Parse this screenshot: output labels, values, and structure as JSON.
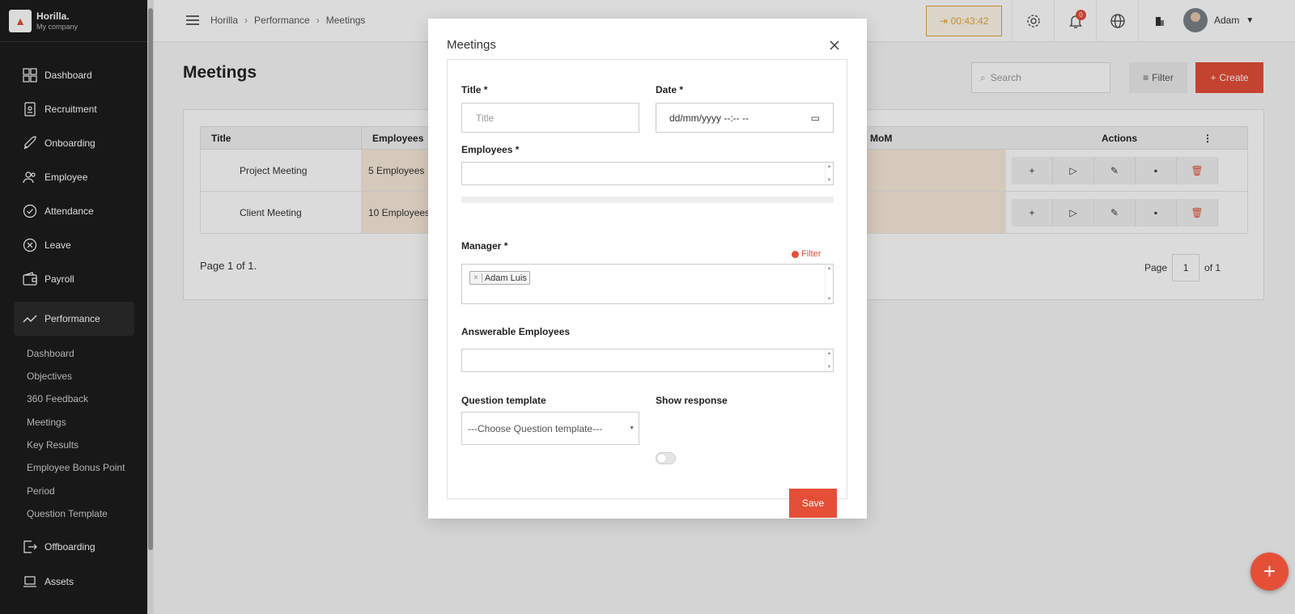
{
  "brand": {
    "name": "Horilla.",
    "company": "My company"
  },
  "sidebar": {
    "items": [
      {
        "label": "Dashboard",
        "icon": "dashboard-icon"
      },
      {
        "label": "Recruitment",
        "icon": "recruitment-icon"
      },
      {
        "label": "Onboarding",
        "icon": "rocket-icon"
      },
      {
        "label": "Employee",
        "icon": "users-icon"
      },
      {
        "label": "Attendance",
        "icon": "check-circle-icon"
      },
      {
        "label": "Leave",
        "icon": "x-circle-icon"
      },
      {
        "label": "Payroll",
        "icon": "wallet-icon"
      },
      {
        "label": "Performance",
        "icon": "trend-icon"
      },
      {
        "label": "Offboarding",
        "icon": "exit-icon"
      },
      {
        "label": "Assets",
        "icon": "laptop-icon"
      }
    ],
    "performance_sub": [
      "Dashboard",
      "Objectives",
      "360 Feedback",
      "Meetings",
      "Key Results",
      "Employee Bonus Point",
      "Period",
      "Question Template"
    ]
  },
  "topbar": {
    "breadcrumbs": [
      "Horilla",
      "Performance",
      "Meetings"
    ],
    "timer": "00:43:42",
    "notification_count": "0",
    "user_name": "Adam"
  },
  "page": {
    "title": "Meetings",
    "search_placeholder": "Search",
    "filter_label": "Filter",
    "create_label": "Create"
  },
  "table": {
    "headers": {
      "title": "Title",
      "employees": "Employees",
      "mom": "MoM",
      "actions": "Actions"
    },
    "rows": [
      {
        "title": "Project Meeting",
        "employees": "5 Employees"
      },
      {
        "title": "Client Meeting",
        "employees": "10 Employees"
      }
    ],
    "page_info": "Page 1 of 1.",
    "pager": {
      "label": "Page",
      "current": "1",
      "of": "of 1"
    }
  },
  "modal": {
    "title": "Meetings",
    "title_label": "Title",
    "title_placeholder": "Title",
    "date_label": "Date",
    "date_placeholder": "dd/mm/yyyy --:-- --",
    "employees_label": "Employees",
    "filter_link": "Filter",
    "manager_label": "Manager",
    "manager_selected": "Adam Luis",
    "answerable_label": "Answerable Employees",
    "question_template_label": "Question template",
    "question_template_value": "---Choose Question template---",
    "show_response_label": "Show response",
    "show_response_on": false,
    "save_label": "Save",
    "required_mark": "*"
  },
  "colors": {
    "accent": "#e54f38",
    "sidebar": "#1c1c1c",
    "timer": "#e2a83c",
    "row_highlight": "#f8ebda"
  }
}
